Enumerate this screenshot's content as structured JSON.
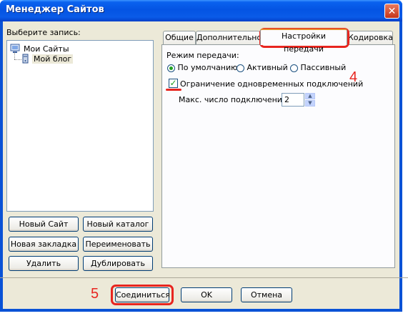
{
  "window": {
    "title": "Менеджер Сайтов",
    "close_glyph": "✕"
  },
  "left": {
    "select_label": "Выберите запись:",
    "tree": {
      "root": "Мои Сайты",
      "child": "Мой блог"
    },
    "buttons": {
      "new_site": "Новый Сайт",
      "new_folder": "Новый каталог",
      "new_bookmark": "Новая закладка",
      "rename": "Переименовать",
      "delete": "Удалить",
      "duplicate": "Дублировать"
    }
  },
  "tabs": [
    "Общие",
    "Дополнительно",
    "Настройки передачи",
    "Кодировка"
  ],
  "transfer": {
    "mode_label": "Режим передачи:",
    "modes": [
      "По умолчанию",
      "Активный",
      "Пассивный"
    ],
    "limit_label": "Ограничение одновременных подключений",
    "max_label": "Макс. число подключений:",
    "max_value": "2"
  },
  "footer": {
    "connect": "Соединиться",
    "ok": "OK",
    "cancel": "Отмена"
  },
  "annotations": {
    "step4": "4",
    "step5": "5"
  },
  "colors": {
    "accent": "#e8251f",
    "titlebar": "#0a52d6",
    "dialog_bg": "#ece9d8"
  }
}
